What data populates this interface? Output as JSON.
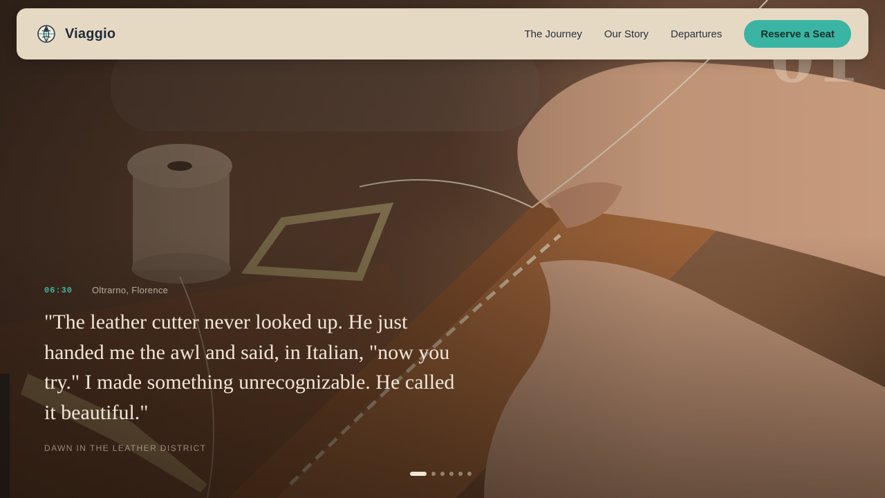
{
  "brand": {
    "name": "Viaggio",
    "logo_icon": "globe-emblem-icon"
  },
  "nav": {
    "links": [
      "The Journey",
      "Our Story",
      "Departures"
    ],
    "cta_label": "Reserve a Seat"
  },
  "hero": {
    "slide_number": "01",
    "time": "06:30",
    "place": "Oltrarno, Florence",
    "quote": "\"The leather cutter never looked up. He just handed me the awl and said, in Italian, \"now you try.\" I made something unrecognizable. He called it beautiful.\"",
    "caption": "Dawn in the leather district"
  },
  "slider": {
    "total_slides": 6,
    "active_index": 0
  },
  "colors": {
    "navbar_bg": "#e6d9c4",
    "accent": "#3ab5a3",
    "brand_text": "#1f2a36",
    "quote_text": "#f1e7d8"
  }
}
